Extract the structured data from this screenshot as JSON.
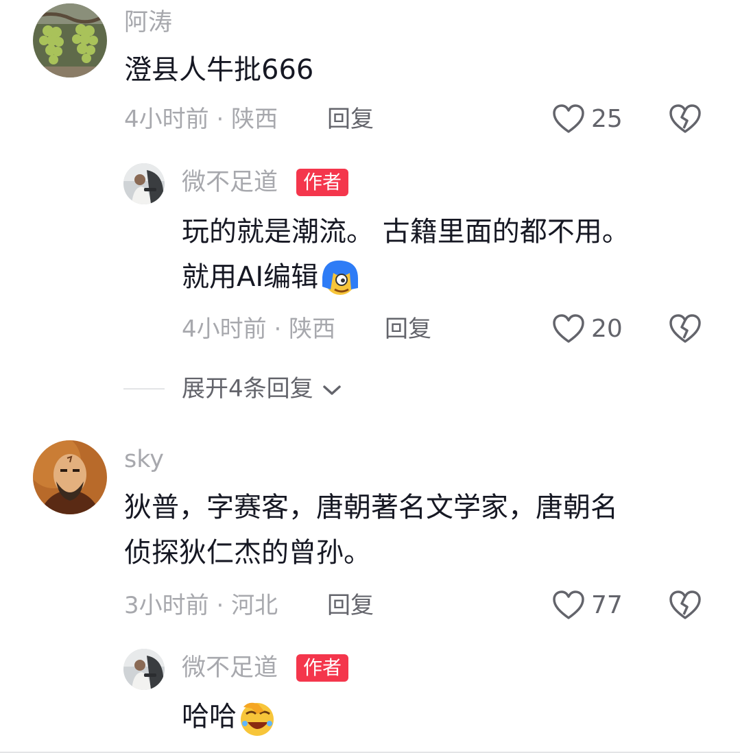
{
  "comments": [
    {
      "user": "阿涛",
      "text_lines": [
        "澄县人牛批666"
      ],
      "time": "4小时前",
      "location": "陕西",
      "reply_label": "回复",
      "likes": "25",
      "replies": [
        {
          "user": "微不足道",
          "badge": "作者",
          "text_lines": [
            "玩的就是潮流。 古籍里面的都不用。",
            "就用AI编辑"
          ],
          "time": "4小时前",
          "location": "陕西",
          "reply_label": "回复",
          "likes": "20"
        }
      ],
      "expand_label": "展开4条回复"
    },
    {
      "user": "sky",
      "text_lines": [
        "狄普，字赛客，唐朝著名文学家，唐朝名",
        "侦探狄仁杰的曾孙。"
      ],
      "time": "3小时前",
      "location": "河北",
      "reply_label": "回复",
      "likes": "77",
      "replies": [
        {
          "user": "微不足道",
          "badge": "作者",
          "text_lines": [
            "哈哈"
          ]
        }
      ]
    }
  ],
  "separator": "·",
  "icons": {
    "like": "heart-outline-icon",
    "dislike": "broken-heart-icon",
    "expand": "chevron-down-icon"
  },
  "colors": {
    "badge": "#f4364c",
    "meta": "#a7a8ad",
    "text": "#161823"
  }
}
